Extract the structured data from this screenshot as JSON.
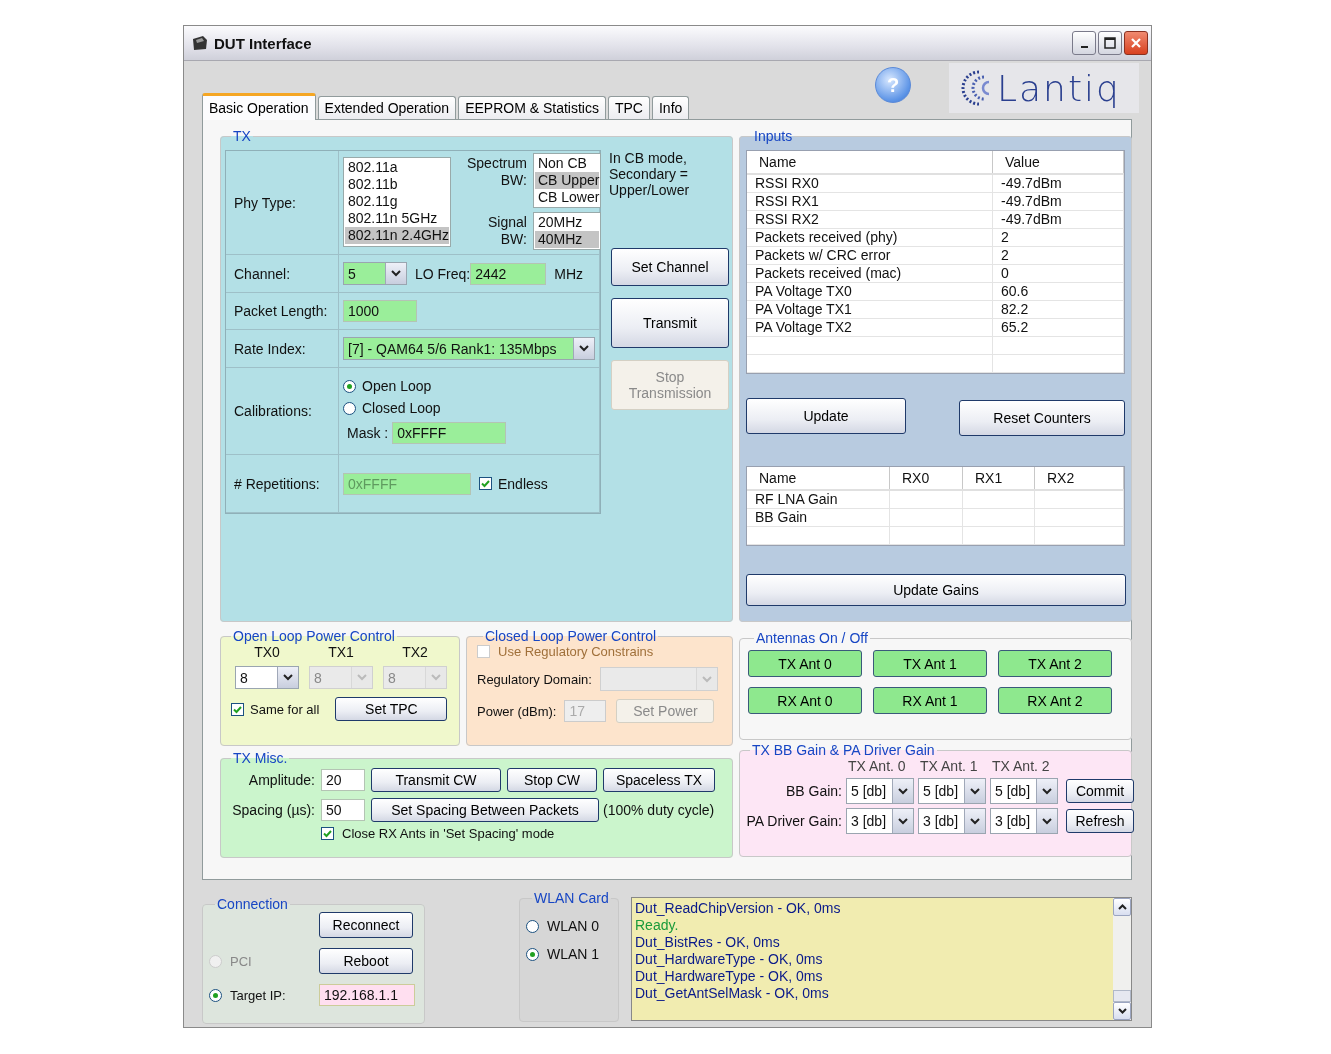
{
  "window": {
    "title": "DUT Interface"
  },
  "help": "?",
  "logo": "Lantiq",
  "tabs": [
    {
      "label": "Basic Operation",
      "selected": true
    },
    {
      "label": "Extended Operation",
      "selected": false
    },
    {
      "label": "EEPROM & Statistics",
      "selected": false
    },
    {
      "label": "TPC",
      "selected": false
    },
    {
      "label": "Info",
      "selected": false
    }
  ],
  "tx": {
    "title": "TX",
    "phy_label": "Phy Type:",
    "phy_types": [
      {
        "label": "802.11a",
        "selected": false
      },
      {
        "label": "802.11b",
        "selected": false
      },
      {
        "label": "802.11g",
        "selected": false
      },
      {
        "label": "802.11n 5GHz",
        "selected": false
      },
      {
        "label": "802.11n 2.4GHz",
        "selected": true
      }
    ],
    "spectrum_label": [
      "Spectrum",
      "BW:"
    ],
    "spectrum_bw": [
      {
        "label": "Non CB",
        "selected": false
      },
      {
        "label": "CB Upper",
        "selected": true
      },
      {
        "label": "CB Lower",
        "selected": false
      }
    ],
    "signal_label": [
      "Signal",
      "BW:"
    ],
    "signal_bw": [
      {
        "label": "20MHz",
        "selected": false
      },
      {
        "label": "40MHz",
        "selected": true
      }
    ],
    "note": "In CB mode, Secondary = Upper/Lower",
    "channel_label": "Channel:",
    "channel": "5",
    "lo_label": "LO Freq:",
    "lo_freq": "2442",
    "lo_unit": "MHz",
    "packet_label": "Packet Length:",
    "packet_length": "1000",
    "rate_label": "Rate Index:",
    "rate": "[7] - QAM64 5/6 Rank1: 135Mbps",
    "calib_label": "Calibrations:",
    "calibrations": [
      {
        "label": "Open Loop",
        "selected": true
      },
      {
        "label": "Closed Loop",
        "selected": false
      }
    ],
    "mask_label": "Mask :",
    "mask": "0xFFFF",
    "rep_label": "# Repetitions:",
    "repetitions": {
      "value": "0xFFFF",
      "disabled": true
    },
    "endless": {
      "label": "Endless",
      "checked": true
    },
    "buttons": [
      {
        "label": "Set Channel",
        "disabled": false
      },
      {
        "label": "Transmit",
        "disabled": false
      },
      {
        "label": "Stop Transmission",
        "disabled": true
      }
    ]
  },
  "inputs": {
    "title": "Inputs",
    "columns": [
      "Name",
      "Value"
    ],
    "rows": [
      [
        "RSSI RX0",
        "-49.7dBm"
      ],
      [
        "RSSI RX1",
        "-49.7dBm"
      ],
      [
        "RSSI RX2",
        "-49.7dBm"
      ],
      [
        "Packets received (phy)",
        "2"
      ],
      [
        "Packets w/ CRC error",
        "2"
      ],
      [
        "Packets received (mac)",
        "0"
      ],
      [
        "PA Voltage TX0",
        "60.6"
      ],
      [
        "PA Voltage TX1",
        "82.2"
      ],
      [
        "PA Voltage TX2",
        "65.2"
      ]
    ],
    "update": "Update",
    "reset": "Reset Counters",
    "gain_columns": [
      "Name",
      "RX0",
      "RX1",
      "RX2"
    ],
    "gain_rows": [
      "RF LNA Gain",
      "BB Gain"
    ],
    "update_gains": "Update Gains"
  },
  "open_loop": {
    "title": "Open Loop Power Control",
    "columns": [
      "TX0",
      "TX1",
      "TX2"
    ],
    "combos": [
      {
        "value": "8",
        "disabled": false
      },
      {
        "value": "8",
        "disabled": true
      },
      {
        "value": "8",
        "disabled": true
      }
    ],
    "same_for_all": {
      "label": "Same for all",
      "checked": true
    },
    "button": "Set TPC"
  },
  "closed_loop": {
    "title": "Closed Loop Power Control",
    "use_regulatory": {
      "label": "Use Regulatory Constrains",
      "checked": false,
      "disabled": true
    },
    "domain_label": "Regulatory Domain:",
    "power_label": "Power (dBm):",
    "power": "17",
    "button": {
      "label": "Set Power",
      "disabled": true
    }
  },
  "antennas": {
    "title": "Antennas On / Off",
    "buttons": [
      {
        "label": "TX Ant 0",
        "on": true
      },
      {
        "label": "TX Ant 1",
        "on": true
      },
      {
        "label": "TX Ant 2",
        "on": true
      },
      {
        "label": "RX Ant 0",
        "on": true
      },
      {
        "label": "RX Ant 1",
        "on": true
      },
      {
        "label": "RX Ant 2",
        "on": true
      }
    ]
  },
  "tx_misc": {
    "title": "TX Misc.",
    "amplitude_label": "Amplitude:",
    "amplitude": "20",
    "spacing_label": "Spacing (µs):",
    "spacing": "50",
    "transmit_cw": "Transmit CW",
    "stop_cw": "Stop CW",
    "set_spacing": "Set Spacing Between Packets",
    "spaceless": "Spaceless TX",
    "duty_note": "(100% duty cycle)",
    "close_rx": {
      "label": "Close RX Ants in 'Set Spacing' mode",
      "checked": true
    }
  },
  "gain": {
    "title": "TX BB Gain & PA Driver Gain",
    "columns": [
      "TX Ant. 0",
      "TX Ant. 1",
      "TX Ant. 2"
    ],
    "rows": [
      {
        "label": "BB Gain:",
        "values": [
          "5 [db]",
          "5 [db]",
          "5 [db]"
        ],
        "button": "Commit"
      },
      {
        "label": "PA Driver Gain:",
        "values": [
          "3 [db]",
          "3 [db]",
          "3 [db]"
        ],
        "button": "Refresh"
      }
    ]
  },
  "connection": {
    "title": "Connection",
    "reconnect": "Reconnect",
    "reboot": "Reboot",
    "radios": [
      {
        "label": "PCI",
        "selected": false,
        "disabled": true
      },
      {
        "label": "Target IP:",
        "selected": true,
        "disabled": false
      }
    ],
    "ip": "192.168.1.1"
  },
  "wlan": {
    "title": "WLAN Card",
    "radios": [
      {
        "label": "WLAN 0",
        "selected": false
      },
      {
        "label": "WLAN 1",
        "selected": true
      }
    ]
  },
  "log": [
    {
      "text": "Dut_ReadChipVersion - OK, 0ms",
      "kind": "result"
    },
    {
      "text": "Ready.",
      "kind": "status"
    },
    {
      "text": "Dut_BistRes - OK, 0ms",
      "kind": "result"
    },
    {
      "text": "Dut_HardwareType - OK, 0ms",
      "kind": "result"
    },
    {
      "text": "Dut_HardwareType - OK, 0ms",
      "kind": "result"
    },
    {
      "text": "Dut_GetAntSelMask - OK, 0ms",
      "kind": "result"
    }
  ]
}
